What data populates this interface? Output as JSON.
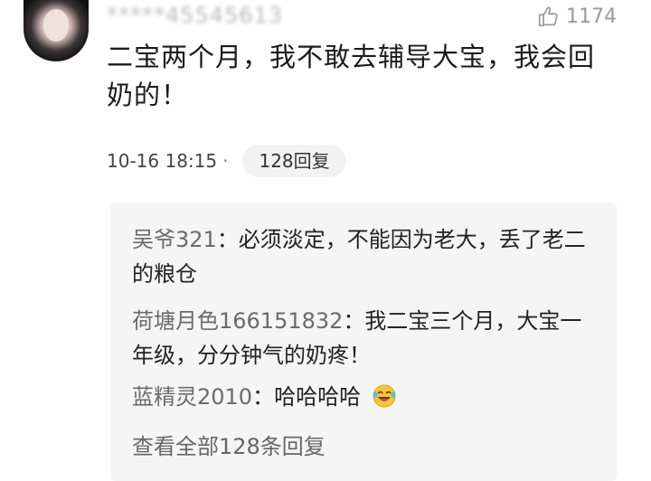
{
  "comment": {
    "username": "*****45545613",
    "like_count": "1174",
    "text": "二宝两个月，我不敢去辅导大宝，我会回奶的！",
    "time": "10-16 18:15",
    "separator": "·",
    "reply_button": "128回复"
  },
  "replies": [
    {
      "name": "吴爷321",
      "text": "：必须淡定，不能因为老大，丢了老二的粮仓"
    },
    {
      "name": "荷塘月色166151832",
      "text": "：我二宝三个月，大宝一年级，分分钟气的奶疼！"
    },
    {
      "name": "蓝精灵2010",
      "text": "：哈哈哈哈",
      "emoji": "laughing-crying-emoji"
    }
  ],
  "see_all": "查看全部128条回复",
  "icons": {
    "like": "thumbs-up-icon",
    "avatar": "user-avatar"
  },
  "colors": {
    "name": "#6b6b6b",
    "reply_bg": "#f5f5f5",
    "like": "#9a9a9a"
  }
}
